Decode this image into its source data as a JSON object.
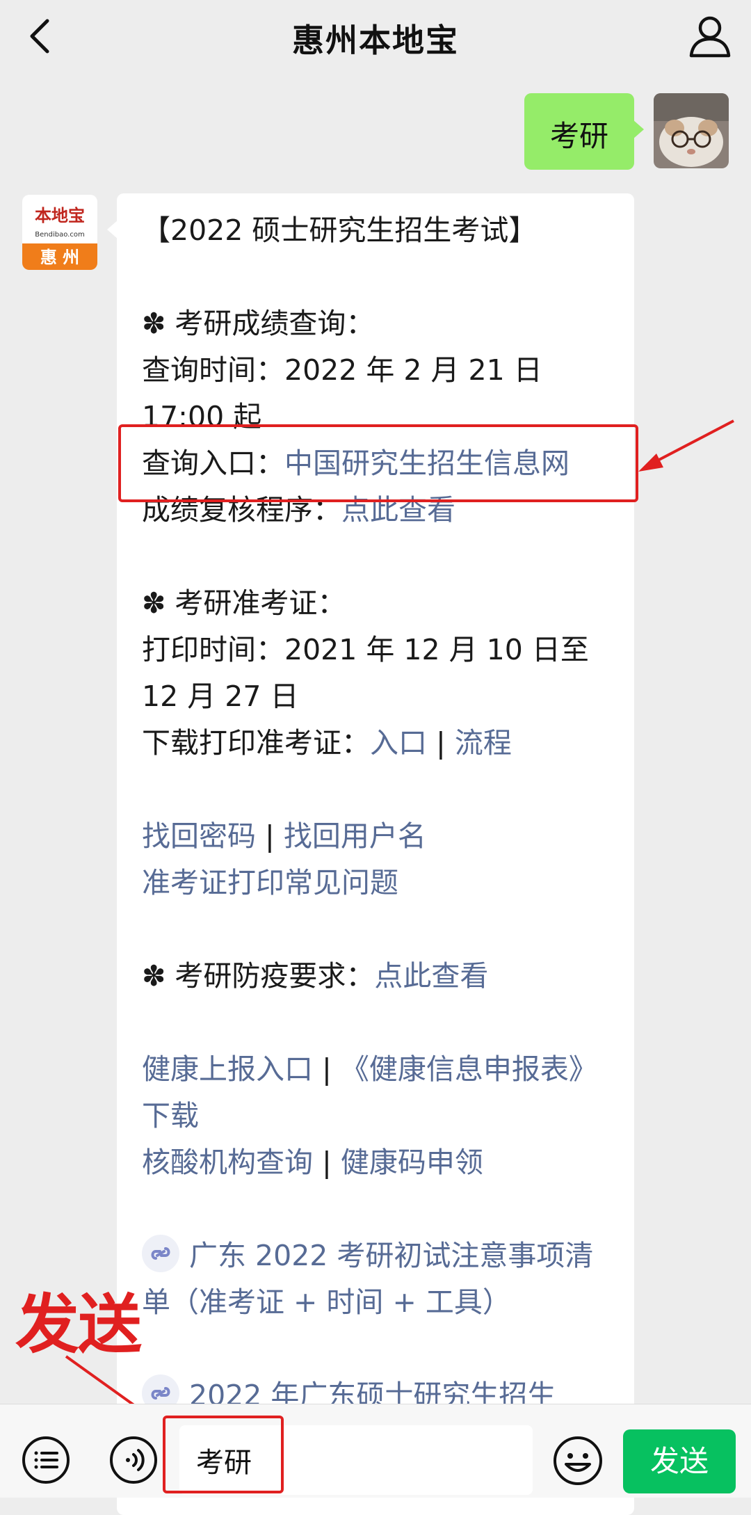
{
  "header": {
    "title": "惠州本地宝"
  },
  "sent_message": {
    "text": "考研"
  },
  "bot_avatar": {
    "line1": "本地宝",
    "line2": "Bendibao.com",
    "line3": "惠 州"
  },
  "bot_message": {
    "title": "【2022 硕士研究生招生考试】",
    "score_section": "✽ 考研成绩查询：",
    "score_time": "查询时间：2022 年 2 月 21 日 17:00 起",
    "score_entry_label": "查询入口：",
    "score_entry_link": "中国研究生招生信息网",
    "review_label": "成绩复核程序：",
    "review_link": "点此查看",
    "admission_section": "✽ 考研准考证：",
    "print_time": "打印时间：2021 年 12 月 10 日至 12 月 27 日",
    "download_label": "下载打印准考证：",
    "download_link1": "入口",
    "download_link2": "流程",
    "sep": " | ",
    "find_password": "找回密码",
    "find_username": "找回用户名",
    "faq_link": "准考证打印常见问题",
    "epidemic_label": "✽ 考研防疫要求：",
    "epidemic_link": "点此查看",
    "health_report": "健康上报入口",
    "health_form": "《健康信息申报表》下载",
    "nucleic": "核酸机构查询",
    "health_code": "健康码申领",
    "article1": "广东 2022 考研初试注意事项清单（准考证 + 时间 + 工具）",
    "article2": "2022 年广东硕士研究生招生"
  },
  "annotation": {
    "text": "发送"
  },
  "input_bar": {
    "value": "考研",
    "send_label": "发送"
  },
  "colors": {
    "link": "#576b95",
    "bubble_green": "#95ec69",
    "send_green": "#07c160",
    "annotation_red": "#e02020"
  }
}
